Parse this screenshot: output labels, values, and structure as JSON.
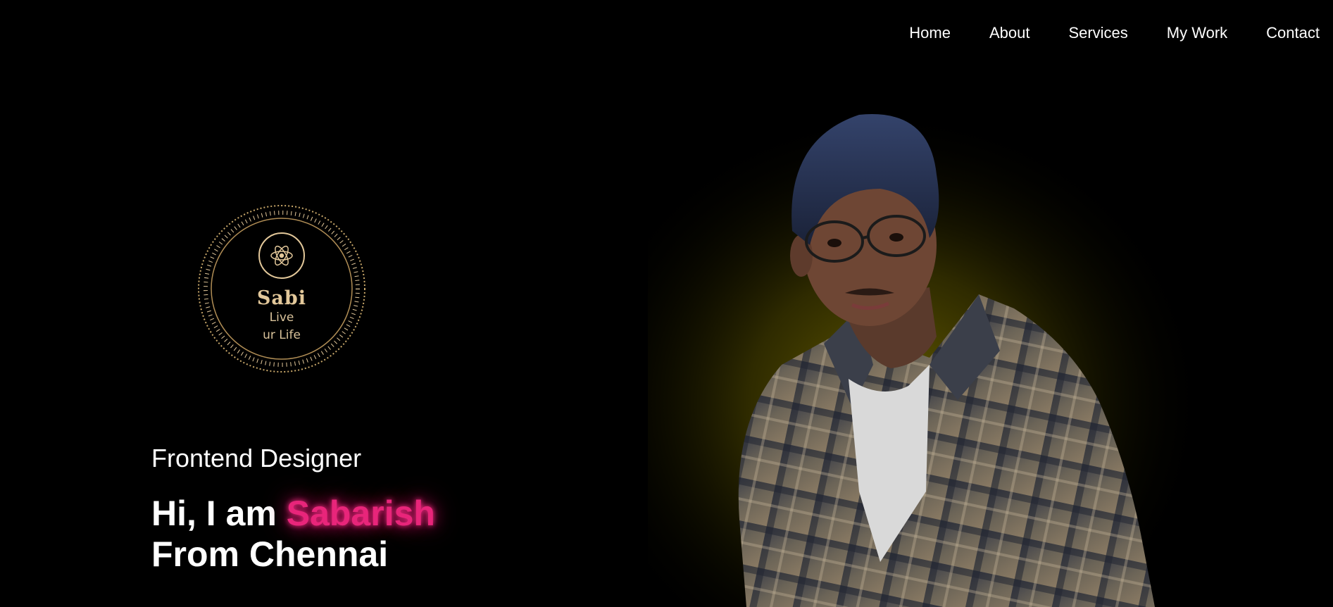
{
  "nav": {
    "items": [
      {
        "label": "Home"
      },
      {
        "label": "About"
      },
      {
        "label": "Services"
      },
      {
        "label": "My Work"
      },
      {
        "label": "Contact"
      }
    ]
  },
  "logo": {
    "title": "Sabi",
    "line1": "Live",
    "line2": "ur Life",
    "icon": "atom-icon"
  },
  "hero": {
    "role": "Frontend Designer",
    "greeting": "Hi, I am ",
    "name": "Sabarish",
    "location": "From Chennai"
  },
  "colors": {
    "background": "#000000",
    "accent": "#e8257a",
    "gold": "#e3c89a",
    "glow": "#6b6200"
  }
}
